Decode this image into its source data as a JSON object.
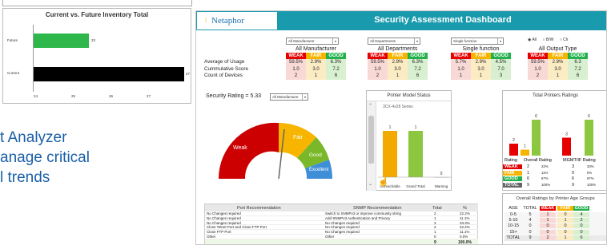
{
  "left_chart": {
    "title": "Current vs. Future Inventory Total",
    "categories": [
      "Future",
      "Current"
    ],
    "values": [
      23,
      27
    ],
    "xticks": [
      "24",
      "25",
      "26",
      "27"
    ],
    "colors": {
      "future": "#2eb84c",
      "current": "#000000"
    }
  },
  "slide_text": {
    "line1": "t Analyzer",
    "line2": "anage critical",
    "line3": "l trends"
  },
  "dashboard": {
    "logo": "Netaphor",
    "title": "Security Assessment Dashboard",
    "header_color": "#1a9bad",
    "filters": [
      {
        "select": "All Manufacturer",
        "label": "All Manufacturer"
      },
      {
        "select": "All Departments",
        "label": "All Departments"
      },
      {
        "select": "Single function",
        "label": "Single function"
      }
    ],
    "output_radio": {
      "options": [
        "All",
        "B/W",
        "Clr"
      ],
      "label": "All Output Type"
    },
    "rating_headers": [
      "WEAK",
      "FAIR",
      "GOOD"
    ],
    "metric_labels": [
      "Average of Usage",
      "Cummulative Score",
      "Count of Devices"
    ],
    "metric_values": [
      [
        [
          "59.5%",
          "2.9%",
          "6.3%"
        ],
        [
          "1.0",
          "3.0",
          "7.2"
        ],
        [
          "2",
          "1",
          "6"
        ]
      ],
      [
        [
          "59.5%",
          "2.9%",
          "6.3%"
        ],
        [
          "1.0",
          "3.0",
          "7.2"
        ],
        [
          "2",
          "1",
          "6"
        ]
      ],
      [
        [
          "5.7%",
          "2.9%",
          "4.5%"
        ],
        [
          "1.0",
          "3.0",
          "7.0"
        ],
        [
          "1",
          "1",
          "3"
        ]
      ],
      [
        [
          "59.5%",
          "2.9%",
          "6.3"
        ],
        [
          "1.0",
          "3.0",
          "7.2"
        ],
        [
          "2",
          "1",
          "6"
        ]
      ]
    ],
    "security_rating": {
      "label": "Security Rating = 5.33",
      "select": "All Manufacturer"
    },
    "gauge": {
      "labels": [
        "Weak",
        "Fair",
        "Good",
        "Excellent"
      ]
    },
    "printer_status": {
      "title": "Printer Model Status",
      "series": "3CX-4x28 Series",
      "chart_data": {
        "type": "bar",
        "categories": [
          "Unreachable",
          "Grand Total",
          "Warning"
        ],
        "values": [
          1,
          1,
          0
        ]
      }
    },
    "total_ratings": {
      "title": "Total Printers Ratings",
      "chart_data": {
        "type": "bar",
        "values_a": [
          2,
          1,
          6
        ],
        "values_b": [
          3,
          0,
          6
        ]
      },
      "bar_labels_a": [
        "2",
        "1",
        "6"
      ],
      "bar_labels_b": [
        "3",
        "6"
      ],
      "table_headers": [
        "Rating",
        "Overall Rating",
        "MGMT/IF Rating"
      ],
      "rows": [
        [
          "WEAK",
          "2",
          "22%",
          "3",
          "33%"
        ],
        [
          "FAIR",
          "1",
          "11%",
          "0",
          "0%"
        ],
        [
          "GOOD",
          "6",
          "67%",
          "6",
          "67%"
        ],
        [
          "TOTAL",
          "9",
          "100%",
          "9",
          "100%"
        ]
      ]
    },
    "recommendations": {
      "headers": [
        "Port Recommendation",
        "SNMP Recommendation",
        "Total",
        "%"
      ],
      "rows": [
        [
          "No Changes required",
          "Switch to SNMPv3 or improve community string",
          "2",
          "22.2%"
        ],
        [
          "No Changes required",
          "Add SNMPv3 Authentication and Privacy",
          "1",
          "11.1%"
        ],
        [
          "No Changes required",
          "No Changes required",
          "3",
          "33.3%"
        ],
        [
          "Close Telnet Port and Close FTP Port",
          "No Changes required",
          "2",
          "22.2%"
        ],
        [
          "Close FTP Port",
          "No Changes required",
          "1",
          "11.1%"
        ],
        [
          "Other",
          "Other",
          "0",
          "0.0%"
        ]
      ],
      "total": [
        "9",
        "100.0%"
      ]
    },
    "age_groups": {
      "title": "Overall Ratings by Printer Age Groups",
      "headers": [
        "AGE",
        "TOTAL",
        "WEAK",
        "FAIR",
        "GOOD"
      ],
      "rows": [
        [
          "0-5",
          "5",
          "1",
          "0",
          "4"
        ],
        [
          "5-10",
          "4",
          "1",
          "1",
          "2"
        ],
        [
          "10-15",
          "0",
          "0",
          "0",
          "0"
        ],
        [
          "15+",
          "0",
          "0",
          "0",
          "0"
        ],
        [
          "TOTAL",
          "9",
          "2",
          "1",
          "6"
        ]
      ]
    }
  }
}
